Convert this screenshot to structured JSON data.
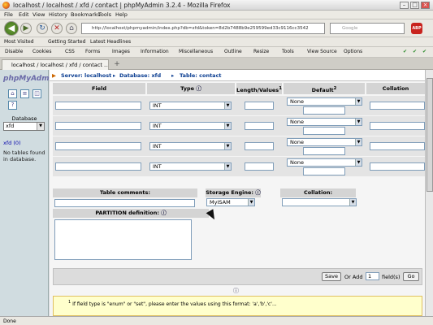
{
  "window": {
    "title": "localhost / localhost / xfd / contact | phpMyAdmin 3.2.4 - Mozilla Firefox"
  },
  "menu": [
    "File",
    "Edit",
    "View",
    "History",
    "Bookmarks",
    "Tools",
    "Help"
  ],
  "nav": {
    "url": "http://localhost/phpmyadmin/index.php?db=xfd&token=8d2b7488b9e259599ed33c9116cc3542",
    "search_placeholder": "Google",
    "adblock": "ABP"
  },
  "bookmarks": [
    "Most Visited",
    "Getting Started",
    "Latest Headlines"
  ],
  "devbar": [
    "Disable",
    "Cookies",
    "CSS",
    "Forms",
    "Images",
    "Information",
    "Miscellaneous",
    "Outline",
    "Resize",
    "Tools",
    "View Source",
    "Options"
  ],
  "tab": {
    "title": "localhost / localhost / xfd / contact ..."
  },
  "sidebar": {
    "logo": "phpMyAdmin",
    "db_label": "Database",
    "db_value": "xfd",
    "db_link": "xfd (0)",
    "no_tables": "No tables found in database."
  },
  "breadcrumb": {
    "server": "Server: localhost",
    "database": "Database: xfd",
    "table": "Table: contact"
  },
  "columns": {
    "field": "Field",
    "type": "Type",
    "length": "Length/Values",
    "length_sup": "1",
    "default": "Default",
    "default_sup": "2",
    "collation": "Collation"
  },
  "rows": [
    {
      "type": "INT",
      "default": "None"
    },
    {
      "type": "INT",
      "default": "None"
    },
    {
      "type": "INT",
      "default": "None"
    },
    {
      "type": "INT",
      "default": "None"
    }
  ],
  "options": {
    "comments_label": "Table comments:",
    "engine_label": "Storage Engine:",
    "engine_value": "MyISAM",
    "collation_label": "Collation:",
    "partition_label": "PARTITION definition:"
  },
  "actions": {
    "save": "Save",
    "or_add": "Or Add",
    "add_count": "1",
    "fields_label": "field(s)",
    "go": "Go"
  },
  "note": {
    "sup": "1",
    "text": "If field type is \"enum\" or \"set\", please enter the values using this format: 'a','b','c'..."
  },
  "status": "Done"
}
